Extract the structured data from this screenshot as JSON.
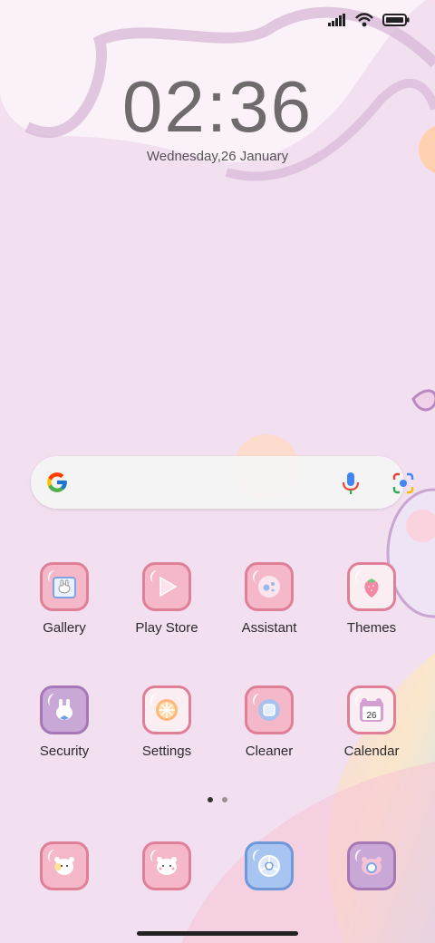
{
  "status_bar": {
    "signal_icon": "signal-icon",
    "wifi_icon": "wifi-icon",
    "battery_icon": "battery-icon"
  },
  "lock_clock": {
    "time": "02:36",
    "date": "Wednesday,26 January"
  },
  "search_widget": {
    "logo_icon": "google-g-icon",
    "voice_icon": "microphone-icon",
    "lens_icon": "camera-lens-icon"
  },
  "apps": [
    {
      "label": "Gallery",
      "icon": "gallery-bunny-frame-icon",
      "color": "#f4b8c8"
    },
    {
      "label": "Play Store",
      "icon": "play-store-triangle-icon",
      "color": "#f4b8c8"
    },
    {
      "label": "Assistant",
      "icon": "assistant-dots-icon",
      "color": "#f4b8c8"
    },
    {
      "label": "Themes",
      "icon": "strawberry-icon",
      "color": "#fbeef2"
    },
    {
      "label": "Security",
      "icon": "security-bunny-icon",
      "color": "#c9a8d8"
    },
    {
      "label": "Settings",
      "icon": "orange-slice-icon",
      "color": "#fbeef2"
    },
    {
      "label": "Cleaner",
      "icon": "cleaner-square-icon",
      "color": "#f4b8c8"
    },
    {
      "label": "Calendar",
      "icon": "calendar-bear-icon",
      "color": "#fbeef2",
      "badge": "26"
    }
  ],
  "page_indicator": {
    "pages": 2,
    "current": 1
  },
  "dock": [
    {
      "icon": "phone-bear-icon",
      "color": "#f4b8c8"
    },
    {
      "icon": "messages-bear-icon",
      "color": "#f4b8c8"
    },
    {
      "icon": "chrome-icon",
      "color": "#a8c4f0"
    },
    {
      "icon": "camera-bear-icon",
      "color": "#c9a8d8"
    }
  ]
}
